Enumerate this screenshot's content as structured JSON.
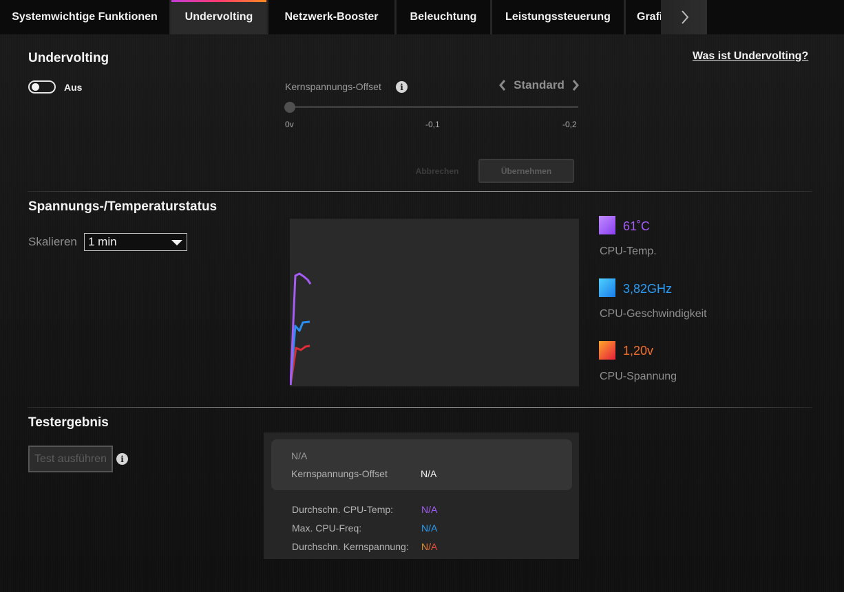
{
  "tabs": [
    {
      "label": "Systemwichtige Funktionen",
      "active": false
    },
    {
      "label": "Undervolting",
      "active": true
    },
    {
      "label": "Netzwerk-Booster",
      "active": false
    },
    {
      "label": "Beleuchtung",
      "active": false
    },
    {
      "label": "Leistungssteuerung",
      "active": false
    },
    {
      "label": "Grafi",
      "active": false
    }
  ],
  "undervolting": {
    "title": "Undervolting",
    "help_link": "Was ist Undervolting?",
    "toggle_label": "Aus",
    "toggle_on": false,
    "offset_label": "Kernspannungs-Offset",
    "info": "i",
    "preset_value": "Standard",
    "slider_value": 0,
    "slider_ticks": [
      "0v",
      "-0,1",
      "-0,2"
    ],
    "cancel_label": "Abbrechen",
    "apply_label": "Übernehmen"
  },
  "status": {
    "title": "Spannungs-/Temperaturstatus",
    "scale_label": "Skalieren",
    "scale_value": "1 min",
    "legend": [
      {
        "value": "61˚C",
        "label": "CPU-Temp.",
        "color": "#a45cf5"
      },
      {
        "value": "3,82GHz",
        "label": "CPU-Geschwindigkeit",
        "color": "#2a8ef0"
      },
      {
        "value": "1,20v",
        "label": "CPU-Spannung",
        "color": "#e85a2c"
      }
    ]
  },
  "test": {
    "title": "Testergebnis",
    "button_label": "Test ausführen",
    "info": "i",
    "card_status": "N/A",
    "card_offset_label": "Kernspannungs-Offset",
    "card_offset_value": "N/A",
    "rows": [
      {
        "label": "Durchschn. CPU-Temp:",
        "value": "N/A",
        "color": "#a45cf5"
      },
      {
        "label": "Max. CPU-Freq:",
        "value": "N/A",
        "color": "#2a9cf5"
      },
      {
        "label": "Durchschn. Kernspannung:",
        "value": "N/A",
        "color": "#f08a2a"
      }
    ]
  }
}
